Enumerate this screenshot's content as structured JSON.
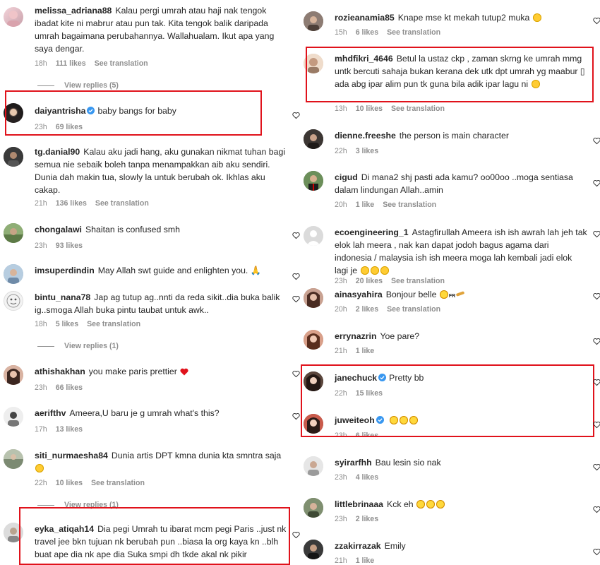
{
  "left": {
    "comments": [
      {
        "user": "melissa_adriana88",
        "verified": false,
        "text": "Kalau pergi umrah atau haji nak tengok ibadat kite ni mabrur atau pun tak. Kita tengok balik daripada umrah bagaimana perubahannya. Wallahualam. Ikut apa yang saya dengar.",
        "time": "18h",
        "likes": "111 likes",
        "translate": "See translation",
        "view_replies": "View replies (5)"
      },
      {
        "user": "daiyantrisha",
        "verified": true,
        "text": "baby bangs for baby",
        "time": "23h",
        "likes": "69 likes",
        "translate": ""
      },
      {
        "user": "tg.danial90",
        "verified": false,
        "text": "Kalau aku jadi hang, aku gunakan nikmat tuhan bagi semua nie sebaik boleh tanpa menampakkan aib aku sendiri. Dunia dah makin tua, slowly la untuk berubah ok. Ikhlas aku cakap.",
        "time": "21h",
        "likes": "136 likes",
        "translate": "See translation"
      },
      {
        "user": "chongalawi",
        "verified": false,
        "text": "Shaitan is confused smh",
        "time": "23h",
        "likes": "93 likes",
        "translate": ""
      },
      {
        "user": "imsuperdindin",
        "verified": false,
        "text": "May Allah swt guide and enlighten you. 🙏",
        "time": "",
        "likes": "",
        "translate": ""
      },
      {
        "user": "bintu_nana78",
        "verified": false,
        "text": "Jap ag tutup ag..nnti da reda sikit..dia buka balik ig..smoga Allah buka pintu taubat untuk awk..",
        "time": "18h",
        "likes": "5 likes",
        "translate": "See translation",
        "view_replies": "View replies (1)"
      },
      {
        "user": "athishakhan",
        "verified": false,
        "text": "you make paris prettier",
        "time": "23h",
        "likes": "66 likes",
        "translate": ""
      },
      {
        "user": "aerifthv",
        "verified": false,
        "text": "Ameera,U baru je g umrah what's this?",
        "time": "17h",
        "likes": "13 likes",
        "translate": ""
      },
      {
        "user": "siti_nurmaesha84",
        "verified": false,
        "text": "Dunia artis DPT kmna dunia kta smntra saja",
        "time": "22h",
        "likes": "10 likes",
        "translate": "See translation",
        "view_replies": "View replies (1)"
      },
      {
        "user": "eyka_atiqah14",
        "verified": false,
        "text": "Dia pegi Umrah tu ibarat mcm pegi Paris ..just nk travel jee bkn tujuan nk berubah pun ..biasa la org kaya kn ..blh buat ape dia nk ape dia Suka smpi dh tkde akal nk pikir",
        "time": "",
        "likes": "",
        "translate": ""
      }
    ]
  },
  "right": {
    "comments": [
      {
        "user": "rozieanamia85",
        "verified": false,
        "text": "Knape mse kt mekah tutup2 muka",
        "time": "15h",
        "likes": "6 likes",
        "translate": "See translation"
      },
      {
        "user": "mhdfikri_4646",
        "verified": false,
        "text": "Betul la ustaz ckp , zaman skrng ke umrah mmg untk bercuti sahaja bukan kerana dek utk dpt umrah yg maabur ▯ ada abg ipar alim pun tk guna bila adik ipar lagu ni",
        "time": "13h",
        "likes": "10 likes",
        "translate": "See translation"
      },
      {
        "user": "dienne.freeshe",
        "verified": false,
        "text": "the person is main character",
        "time": "22h",
        "likes": "3 likes",
        "translate": ""
      },
      {
        "user": "cigud",
        "verified": false,
        "text": "Di mana2 shj pasti ada kamu? oo00oo ..moga sentiasa dalam lindungan Allah..amin",
        "time": "20h",
        "likes": "1 like",
        "translate": "See translation"
      },
      {
        "user": "ecoengineering_1",
        "verified": false,
        "text": "Astagfirullah Ameera ish ish awrah lah jeh tak elok lah meera , nak kan dapat jodoh bagus agama dari indonesia / malaysia ish ish meera moga lah kembali jadi elok lagi je",
        "time": "23h",
        "likes": "20 likes",
        "translate": "See translation"
      },
      {
        "user": "ainasyahira",
        "verified": false,
        "text": "Bonjour belle",
        "time": "20h",
        "likes": "2 likes",
        "translate": "See translation"
      },
      {
        "user": "errynazrin",
        "verified": false,
        "text": "Yoe pare?",
        "time": "21h",
        "likes": "1 like",
        "translate": ""
      },
      {
        "user": "janechuck",
        "verified": true,
        "text": "Pretty bb",
        "time": "22h",
        "likes": "15 likes",
        "translate": ""
      },
      {
        "user": "juweiteoh",
        "verified": true,
        "text": "",
        "time": "23h",
        "likes": "6 likes",
        "translate": ""
      },
      {
        "user": "syirarfhh",
        "verified": false,
        "text": "Bau lesin sio nak",
        "time": "23h",
        "likes": "4 likes",
        "translate": ""
      },
      {
        "user": "littlebrinaaa",
        "verified": false,
        "text": "Kck eh",
        "time": "23h",
        "likes": "2 likes",
        "translate": ""
      },
      {
        "user": "zzakirrazak",
        "verified": false,
        "text": "Emily",
        "time": "21h",
        "likes": "1 like",
        "translate": ""
      }
    ]
  },
  "colors": {
    "highlight": "#e0121b",
    "verified": "#3897f0",
    "muted": "#8e8e8e",
    "text": "#262626",
    "heart_red": "#ed1c3a"
  },
  "icons": {
    "like": "heart-outline-icon",
    "verified": "verified-badge-icon"
  }
}
